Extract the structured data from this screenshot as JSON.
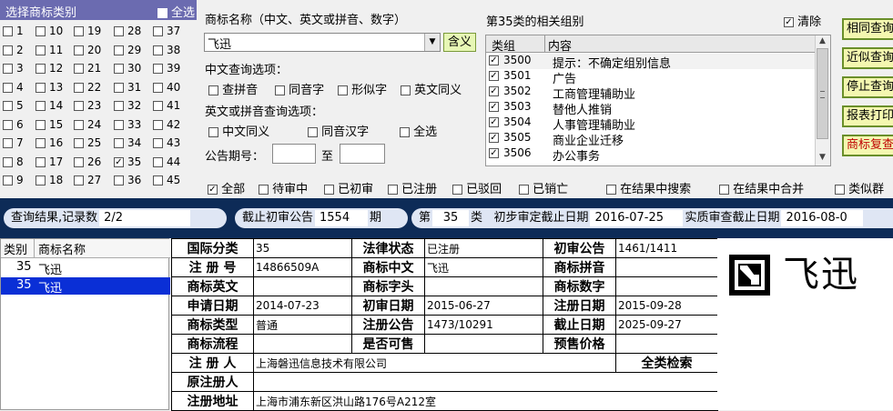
{
  "class_panel": {
    "title": "选择商标类别",
    "select_all": "全选",
    "classes": [
      {
        "n": "1",
        "on": false
      },
      {
        "n": "10",
        "on": false
      },
      {
        "n": "19",
        "on": false
      },
      {
        "n": "28",
        "on": false
      },
      {
        "n": "37",
        "on": false
      },
      {
        "n": "2",
        "on": false
      },
      {
        "n": "11",
        "on": false
      },
      {
        "n": "20",
        "on": false
      },
      {
        "n": "29",
        "on": false
      },
      {
        "n": "38",
        "on": false
      },
      {
        "n": "3",
        "on": false
      },
      {
        "n": "12",
        "on": false
      },
      {
        "n": "21",
        "on": false
      },
      {
        "n": "30",
        "on": false
      },
      {
        "n": "39",
        "on": false
      },
      {
        "n": "4",
        "on": false
      },
      {
        "n": "13",
        "on": false
      },
      {
        "n": "22",
        "on": false
      },
      {
        "n": "31",
        "on": false
      },
      {
        "n": "40",
        "on": false
      },
      {
        "n": "5",
        "on": false
      },
      {
        "n": "14",
        "on": false
      },
      {
        "n": "23",
        "on": false
      },
      {
        "n": "32",
        "on": false
      },
      {
        "n": "41",
        "on": false
      },
      {
        "n": "6",
        "on": false
      },
      {
        "n": "15",
        "on": false
      },
      {
        "n": "24",
        "on": false
      },
      {
        "n": "33",
        "on": false
      },
      {
        "n": "42",
        "on": false
      },
      {
        "n": "7",
        "on": false
      },
      {
        "n": "16",
        "on": false
      },
      {
        "n": "25",
        "on": false
      },
      {
        "n": "34",
        "on": false
      },
      {
        "n": "43",
        "on": false
      },
      {
        "n": "8",
        "on": false
      },
      {
        "n": "17",
        "on": false
      },
      {
        "n": "26",
        "on": false
      },
      {
        "n": "35",
        "on": true
      },
      {
        "n": "44",
        "on": false
      },
      {
        "n": "9",
        "on": false
      },
      {
        "n": "18",
        "on": false
      },
      {
        "n": "27",
        "on": false
      },
      {
        "n": "36",
        "on": false
      },
      {
        "n": "45",
        "on": false
      }
    ]
  },
  "search": {
    "name_label": "商标名称（中文、英文或拼音、数字）",
    "name_value": "飞迅",
    "meaning_button": "含义",
    "cn_options_label": "中文查询选项：",
    "cn_options": [
      "查拼音",
      "同音字",
      "形似字",
      "英文同义"
    ],
    "en_options_label": "英文或拼音查询选项：",
    "en_options": [
      "中文同义",
      "同音汉字",
      "全选"
    ],
    "announce_label": "公告期号：",
    "to_label": "至",
    "announce_from": "",
    "announce_to": ""
  },
  "groups": {
    "title": "第35类的相关组别",
    "clear_label": "清除",
    "col_group": "类组",
    "col_content": "内容",
    "rows": [
      {
        "code": "3500",
        "desc": "提示：不确定组别信息"
      },
      {
        "code": "3501",
        "desc": "广告"
      },
      {
        "code": "3502",
        "desc": "工商管理辅助业"
      },
      {
        "code": "3503",
        "desc": "替他人推销"
      },
      {
        "code": "3504",
        "desc": "人事管理辅助业"
      },
      {
        "code": "3505",
        "desc": "商业企业迁移"
      },
      {
        "code": "3506",
        "desc": "办公事务"
      }
    ]
  },
  "right_buttons": [
    "相同查询",
    "近似查询",
    "停止查询",
    "报表打印",
    "商标复查"
  ],
  "filters": {
    "status": [
      {
        "label": "全部",
        "on": true
      },
      {
        "label": "待审中",
        "on": false
      },
      {
        "label": "已初审",
        "on": false
      },
      {
        "label": "已注册",
        "on": false
      },
      {
        "label": "已驳回",
        "on": false
      },
      {
        "label": "已销亡",
        "on": false
      }
    ],
    "search_in_results": "在结果中搜索",
    "merge_in_results": "在结果中合并",
    "similar_group": "类似群"
  },
  "status_bar": {
    "result_label": "查询结果,记录数",
    "result_count": "2/2",
    "cutoff_label": "截止初审公告",
    "cutoff_value": "1554",
    "cutoff_unit": "期",
    "class_prefix": "第",
    "class_value": "35",
    "class_suffix": "类",
    "prelim_label": "初步审定截止日期",
    "prelim_date": "2016-07-25",
    "subst_label": "实质审查截止日期",
    "subst_date": "2016-08-0"
  },
  "result_list": {
    "col_class": "类别",
    "col_name": "商标名称",
    "rows": [
      {
        "cls": "35",
        "name": "飞迅",
        "selected": false
      },
      {
        "cls": "35",
        "name": "飞迅",
        "selected": true
      }
    ]
  },
  "detail": {
    "r1": {
      "k1": "国际分类",
      "v1": "35",
      "k2": "法律状态",
      "v2": "已注册",
      "k3": "初审公告",
      "v3": "1461/1411"
    },
    "r2": {
      "k1": "注 册 号",
      "v1": "14866509A",
      "k2": "商标中文",
      "v2": "飞迅",
      "k3": "商标拼音",
      "v3": ""
    },
    "r3": {
      "k1": "商标英文",
      "v1": "",
      "k2": "商标字头",
      "v2": "",
      "k3": "商标数字",
      "v3": ""
    },
    "r4": {
      "k1": "申请日期",
      "v1": "2014-07-23",
      "k2": "初审日期",
      "v2": "2015-06-27",
      "k3": "注册日期",
      "v3": "2015-09-28"
    },
    "r5": {
      "k1": "商标类型",
      "v1": "普通",
      "k2": "注册公告",
      "v2": "1473/10291",
      "k3": "截止日期",
      "v3": "2025-09-27"
    },
    "r6": {
      "k1": "商标流程",
      "v1": "",
      "k2": "是否可售",
      "v2": "",
      "k3": "预售价格",
      "v3": ""
    },
    "r7": {
      "k1": "注 册 人",
      "v1": "上海磐迅信息技术有限公司",
      "k3": "全类检索"
    },
    "r8": {
      "k1": "原注册人",
      "v1": ""
    },
    "r9": {
      "k1": "注册地址",
      "v1": "上海市浦东新区洪山路176号A212室"
    }
  },
  "logo": {
    "text": "飞迅"
  }
}
